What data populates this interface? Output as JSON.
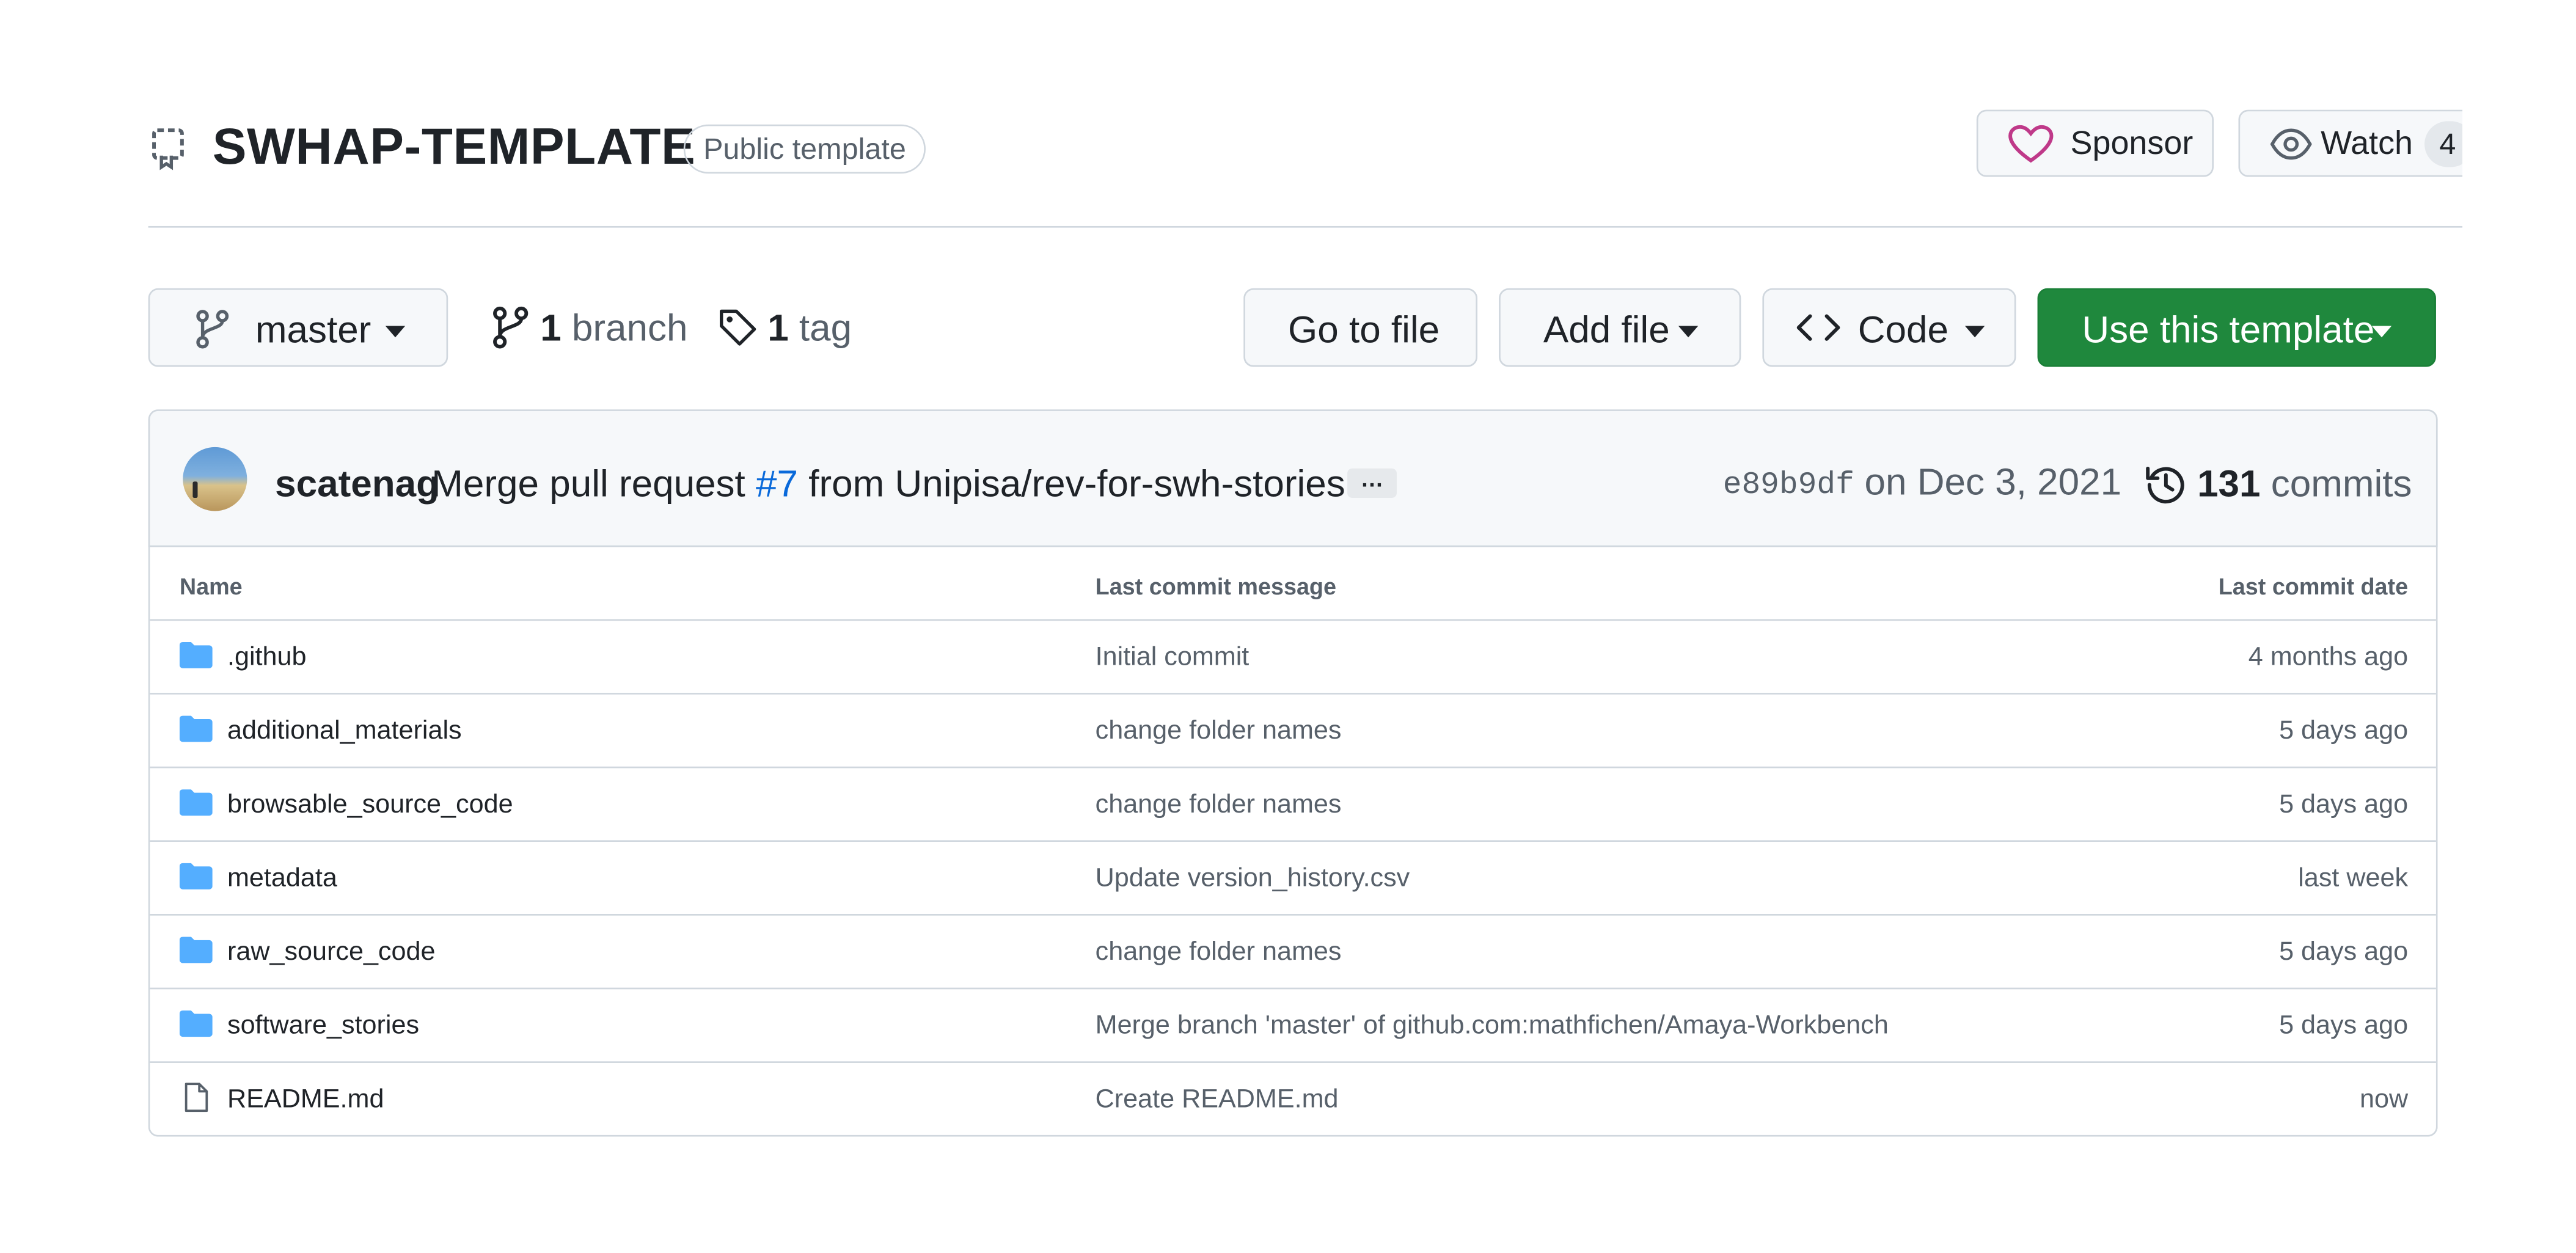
{
  "repo": {
    "name": "SWHAP-TEMPLATE",
    "visibility": "Public template",
    "sponsor_label": "Sponsor",
    "watch_label": "Watch",
    "watch_count": "4"
  },
  "toolbar": {
    "branch": "master",
    "branches_count": "1",
    "branches_label": "branch",
    "tags_count": "1",
    "tags_label": "tag",
    "goto_file": "Go to file",
    "add_file": "Add file",
    "code": "Code",
    "use_template": "Use this template"
  },
  "commit": {
    "author": "scatenag",
    "message_prefix": "Merge pull request",
    "pr_link": "#7",
    "message_suffix": "from Unipisa/rev-for-swh-stories",
    "ellipsis": "…",
    "sha": "e89b9df",
    "date": "on Dec 3, 2021",
    "commits_count": "131",
    "commits_label": "commits"
  },
  "table": {
    "headers": {
      "name": "Name",
      "message": "Last commit message",
      "date": "Last commit date"
    },
    "rows": [
      {
        "type": "folder",
        "name": ".github",
        "message": "Initial commit",
        "date": "4 months ago"
      },
      {
        "type": "folder",
        "name": "additional_materials",
        "message": "change folder names",
        "date": "5 days ago"
      },
      {
        "type": "folder",
        "name": "browsable_source_code",
        "message": "change folder names",
        "date": "5 days ago"
      },
      {
        "type": "folder",
        "name": "metadata",
        "message": "Update version_history.csv",
        "date": "last week"
      },
      {
        "type": "folder",
        "name": "raw_source_code",
        "message": "change folder names",
        "date": "5 days ago"
      },
      {
        "type": "folder",
        "name": "software_stories",
        "message": "Merge branch 'master' of github.com:mathfichen/Amaya-Workbench",
        "date": "5 days ago"
      },
      {
        "type": "file",
        "name": "README.md",
        "message": "Create README.md",
        "date": "now"
      }
    ]
  },
  "colors": {
    "accent_green": "#1f883d",
    "link_blue": "#0969da",
    "folder_blue": "#54aeff",
    "sponsor_pink": "#bf3989",
    "border": "#d0d7de",
    "muted_text": "#57606a"
  },
  "icons": {
    "template": "repo-template-icon",
    "sponsor": "heart-icon",
    "watch": "eye-icon",
    "branch": "git-branch-icon",
    "tag": "tag-icon",
    "code": "code-icon",
    "history": "history-icon",
    "folder": "folder-icon",
    "file": "file-icon"
  }
}
